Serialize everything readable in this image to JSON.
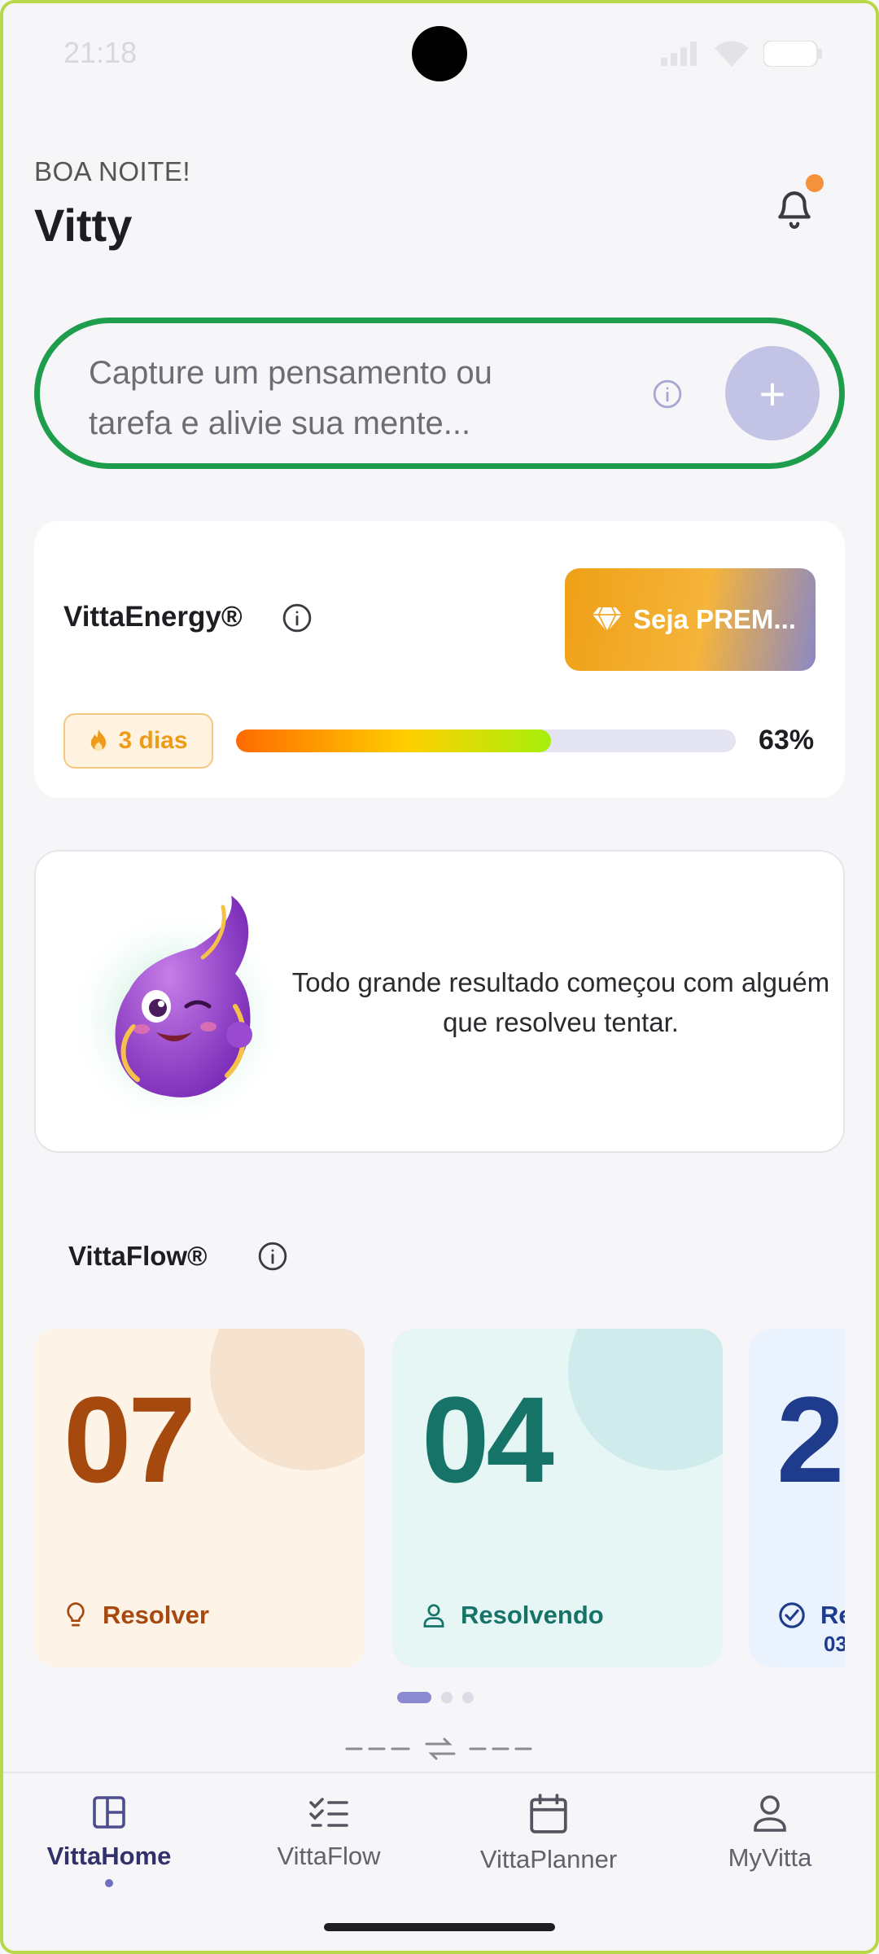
{
  "status_bar": {
    "time": "21:18"
  },
  "header": {
    "greeting": "BOA NOITE!",
    "user_name": "Vitty",
    "icons": {
      "notifications": "bell-icon"
    },
    "colors": {
      "notification_dot": "#f5913b"
    }
  },
  "capture": {
    "placeholder": "Capture um pensamento ou tarefa e alivie sua mente...",
    "add_label": "+",
    "colors": {
      "highlight_border": "#1e9d4c",
      "add_button": "#c3c3e6"
    }
  },
  "energy": {
    "title": "VittaEnergy®",
    "premium_label": "Seja PREM...",
    "premium_icon": "diamond-icon",
    "streak": "3 dias",
    "streak_icon": "flame-icon",
    "progress_fraction": 0.63,
    "progress_label": "63%"
  },
  "quote": {
    "text": "Todo grande resultado começou com alguém que resolveu tentar.",
    "mascot": "purple-flame-mascot"
  },
  "flow": {
    "title": "VittaFlow®",
    "cards": [
      {
        "number": "07",
        "label": "Resolver",
        "sub": "",
        "icon": "lightbulb-icon",
        "bg": "#fdf3e6",
        "circle": "#f5e3d0",
        "color": "#a5490e"
      },
      {
        "number": "04",
        "label": "Resolvendo",
        "sub": "",
        "icon": "person-icon",
        "bg": "#e6f6f5",
        "circle": "#cfebeb",
        "color": "#167368"
      },
      {
        "number": "2",
        "label": "Re",
        "sub": "03",
        "icon": "check-circle-icon",
        "bg": "#eaf2fd",
        "circle": "#d6e5f9",
        "color": "#1e3b8c"
      }
    ]
  },
  "nav": {
    "items": [
      {
        "label": "VittaHome",
        "icon": "dashboard-icon"
      },
      {
        "label": "VittaFlow",
        "icon": "checklist-icon"
      },
      {
        "label": "VittaPlanner",
        "icon": "calendar-icon"
      },
      {
        "label": "MyVitta",
        "icon": "user-icon"
      }
    ],
    "active_index": 0
  }
}
